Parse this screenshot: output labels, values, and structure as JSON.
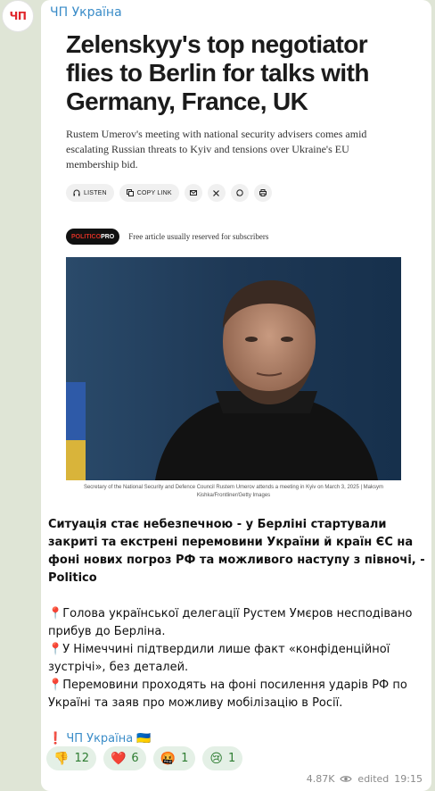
{
  "channel": {
    "avatar_text": "ЧП",
    "name": "ЧП Україна"
  },
  "article": {
    "headline": "Zelenskyy's top negotiator flies to Berlin for talks with Germany, France, UK",
    "subhead": "Rustem Umerov's meeting with national security advisers comes amid escalating Russian threats to Kyiv and tensions over Ukraine's EU membership bid.",
    "share": {
      "listen": "LISTEN",
      "copy_link": "COPY LINK"
    },
    "pro_badge_left": "POLITICO",
    "pro_badge_right": "PRO",
    "pro_text": "Free article usually reserved for subscribers",
    "caption": "Secretary of the National Security and Defence Council Rustem Umerov attends a meeting in Kyiv on March 3, 2025 | Maksym Kishka/Frontliner/Getty Images"
  },
  "message": {
    "lead": "Ситуація стає небезпечною - у Берліні стартували закриті та екстрені перемовини України й країн ЄС на фоні нових погроз РФ та можливого наступу з півночі, - Politico",
    "bullets": [
      "Голова української делегації Рустем Умєров несподівано прибув до Берліна.",
      "У Німеччині підтвердили лише факт «конфіденційної зустрічі», без деталей.",
      "Перемовини проходять на фоні посилення ударів РФ по Україні та заяв про можливу мобілізацію в Росії."
    ],
    "signature": "ЧП Україна",
    "signature_flag": "🇺🇦",
    "signature_mark": "❗"
  },
  "reactions": [
    {
      "emoji": "👎",
      "count": "12"
    },
    {
      "emoji": "❤️",
      "count": "6"
    },
    {
      "emoji": "🤬",
      "count": "1"
    },
    {
      "emoji": "😢",
      "count": "1"
    }
  ],
  "meta": {
    "views": "4.87K",
    "edited": "edited",
    "time": "19:15"
  },
  "colors": {
    "accent": "#3a8cc8",
    "background": "#dfe5d6",
    "reaction_bg": "#e4f0e6"
  }
}
